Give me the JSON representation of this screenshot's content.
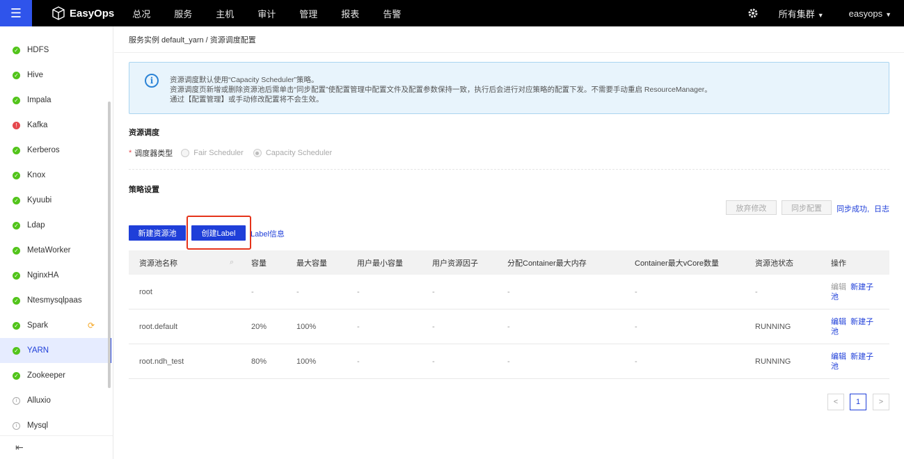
{
  "topnav": {
    "brand": "EasyOps",
    "items": [
      "总况",
      "服务",
      "主机",
      "审计",
      "管理",
      "报表",
      "告警"
    ],
    "cluster": "所有集群",
    "user": "easyops"
  },
  "sidebar": {
    "items": [
      {
        "label": "HDFS",
        "status": "ok"
      },
      {
        "label": "Hive",
        "status": "ok"
      },
      {
        "label": "Impala",
        "status": "ok"
      },
      {
        "label": "Kafka",
        "status": "error"
      },
      {
        "label": "Kerberos",
        "status": "ok"
      },
      {
        "label": "Knox",
        "status": "ok"
      },
      {
        "label": "Kyuubi",
        "status": "ok"
      },
      {
        "label": "Ldap",
        "status": "ok"
      },
      {
        "label": "MetaWorker",
        "status": "ok"
      },
      {
        "label": "NginxHA",
        "status": "ok"
      },
      {
        "label": "Ntesmysqlpaas",
        "status": "ok"
      },
      {
        "label": "Spark",
        "status": "ok"
      },
      {
        "label": "YARN",
        "status": "ok"
      },
      {
        "label": "Zookeeper",
        "status": "ok"
      },
      {
        "label": "Alluxio",
        "status": "info"
      },
      {
        "label": "Mysql",
        "status": "info"
      }
    ]
  },
  "breadcrumb": "服务实例 default_yarn / 资源调度配置",
  "alert": {
    "lines": [
      "资源调度默认使用“Capacity Scheduler”策略。",
      "资源调度页新增或删除资源池后需单击“同步配置”使配置管理中配置文件及配置参数保持一致，执行后会进行对应策略的配置下发。不需要手动重启 ResourceManager。",
      "通过【配置管理】或手动修改配置将不会生效。"
    ]
  },
  "scheduling": {
    "title": "资源调度",
    "field_label": "调度器类型",
    "options": [
      "Fair Scheduler",
      "Capacity Scheduler"
    ]
  },
  "policy": {
    "title": "策略设置",
    "discard_button": "放弃修改",
    "sync_button": "同步配置",
    "sync_status": "同步成功,",
    "log_link": "日志",
    "new_pool_button": "新建资源池",
    "create_label_button": "创建Label",
    "label_info_link": "Label信息"
  },
  "table": {
    "headers": [
      "资源池名称",
      "容量",
      "最大容量",
      "用户最小容量",
      "用户资源因子",
      "分配Container最大内存",
      "Container最大vCore数量",
      "资源池状态",
      "操作"
    ],
    "rows": [
      {
        "name": "root",
        "capacity": "-",
        "max_capacity": "-",
        "user_min": "-",
        "user_factor": "-",
        "max_mem": "-",
        "max_vcore": "-",
        "state": "-",
        "edit": "编辑",
        "new_child": "新建子池"
      },
      {
        "name": "root.default",
        "capacity": "20%",
        "max_capacity": "100%",
        "user_min": "-",
        "user_factor": "-",
        "max_mem": "-",
        "max_vcore": "-",
        "state": "RUNNING",
        "edit": "编辑",
        "new_child": "新建子池"
      },
      {
        "name": "root.ndh_test",
        "capacity": "80%",
        "max_capacity": "100%",
        "user_min": "-",
        "user_factor": "-",
        "max_mem": "-",
        "max_vcore": "-",
        "state": "RUNNING",
        "edit": "编辑",
        "new_child": "新建子池"
      }
    ]
  },
  "pagination": {
    "prev": "<",
    "current": "1",
    "next": ">"
  }
}
